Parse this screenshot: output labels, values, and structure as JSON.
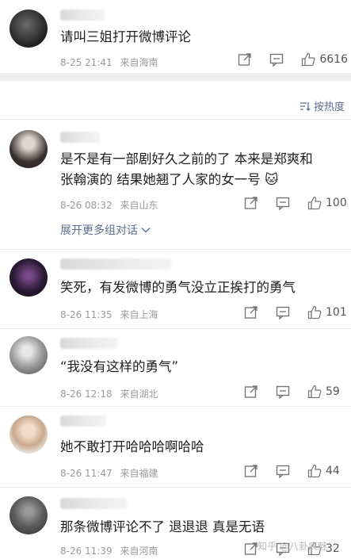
{
  "top_comment": {
    "text": "请叫三姐打开微博评论",
    "date": "8-25 21:41",
    "location": "来自海南",
    "likes": "6616"
  },
  "sort": {
    "label": "按热度"
  },
  "comments": [
    {
      "text": "是不是有一部剧好久之前的了 本来是郑爽和张翰演的 结果她翘了人家的女一号",
      "emoji": "🐱",
      "date": "8-26 08:32",
      "location": "来自山东",
      "likes": "100",
      "expand": "展开更多组对话"
    },
    {
      "text": "笑死，有发微博的勇气没立正挨打的勇气",
      "date": "8-26 11:35",
      "location": "来自上海",
      "likes": "101"
    },
    {
      "text": "“我没有这样的勇气”",
      "date": "8-26 12:18",
      "location": "来自湖北",
      "likes": "59"
    },
    {
      "text": "她不敢打开哈哈哈啊哈哈",
      "date": "8-26 11:47",
      "location": "来自福建",
      "likes": "44"
    },
    {
      "text": "那条微博评论不了  退退退  真是无语",
      "date": "8-26 11:39",
      "location": "来自河南",
      "likes": "32"
    }
  ],
  "watermark": "知乎 @八卦疯魅"
}
